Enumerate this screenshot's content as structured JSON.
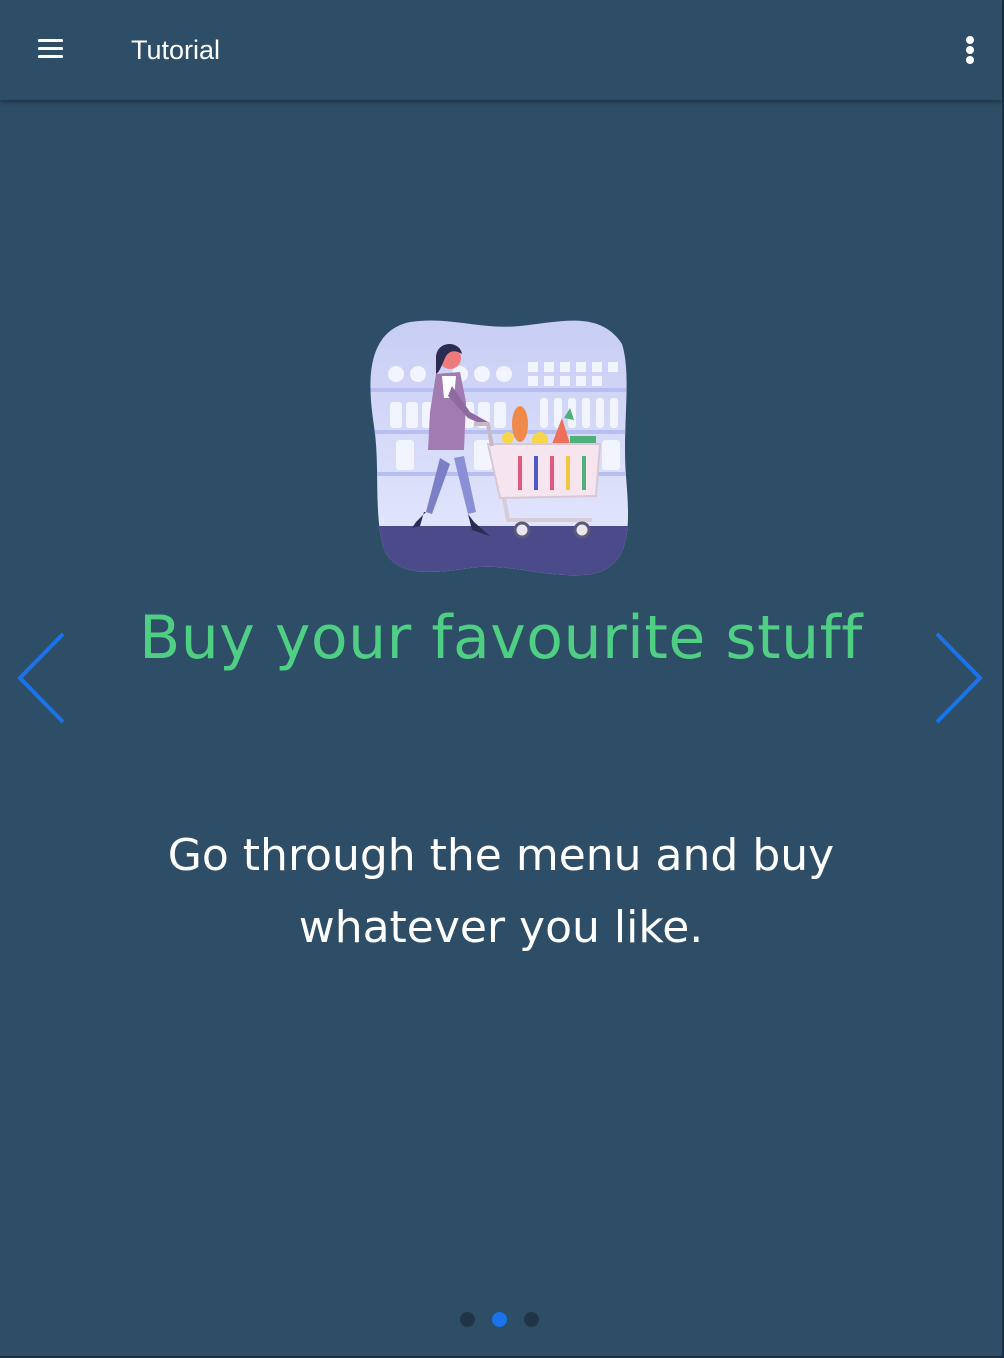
{
  "toolbar": {
    "title": "Tutorial",
    "menu_icon": "hamburger-menu-icon",
    "more_icon": "more-vertical-icon"
  },
  "slide": {
    "title": "Buy your favourite stuff",
    "description": "Go through the menu and buy whatever you like.",
    "illustration": "woman-pushing-shopping-cart-illustration"
  },
  "navigation": {
    "prev_icon": "chevron-left-icon",
    "next_icon": "chevron-right-icon"
  },
  "pagination": {
    "total": 3,
    "active_index": 1
  },
  "colors": {
    "background": "#2e4d67",
    "title": "#4fcf83",
    "accent": "#1a73e8",
    "dot_inactive": "#1f3547"
  }
}
